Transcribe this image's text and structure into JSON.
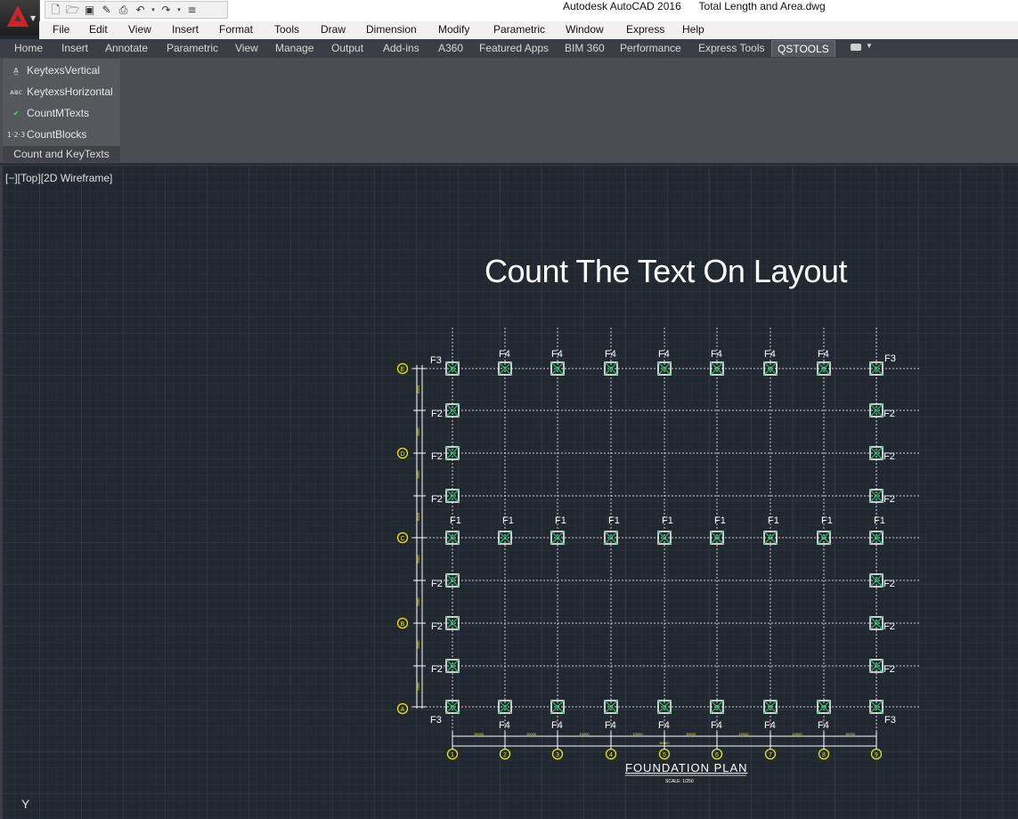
{
  "window": {
    "title": "Autodesk AutoCAD 2016      Total Length and Area.dwg"
  },
  "quick_access": {
    "icons": [
      "new-icon",
      "open-icon",
      "save-icon",
      "saveas-icon",
      "print-icon",
      "undo-icon",
      "redo-icon",
      "customize-icon"
    ]
  },
  "menu": {
    "items": [
      "File",
      "Edit",
      "View",
      "Insert",
      "Format",
      "Tools",
      "Draw",
      "Dimension",
      "Modify",
      "Parametric",
      "Window",
      "Express",
      "Help"
    ]
  },
  "ribbon_tabs": {
    "items": [
      "Home",
      "Insert",
      "Annotate",
      "Parametric",
      "View",
      "Manage",
      "Output",
      "Add-ins",
      "A360",
      "Featured Apps",
      "BIM 360",
      "Performance",
      "Express Tools",
      "QSTOOLS"
    ],
    "active": "QSTOOLS"
  },
  "ribbon_panel": {
    "buttons": [
      {
        "label": "KeytexsVertical",
        "icon": "vertical-text-icon"
      },
      {
        "label": "KeytexsHorizontal",
        "icon": "horizontal-text-icon"
      },
      {
        "label": "CountMTexts",
        "icon": "count-mtext-icon"
      },
      {
        "label": "CountBlocks",
        "icon": "count-blocks-icon"
      }
    ],
    "title": "Count and KeyTexts"
  },
  "viewport": {
    "label": "[−][Top][2D Wireframe]"
  },
  "drawing": {
    "heading": "Count The Text  On Layout",
    "plan_title": "FOUNDATION  PLAN",
    "plan_scale": "SCALE: 1/250",
    "column_axes": [
      "1",
      "2",
      "3",
      "4",
      "5",
      "6",
      "7",
      "8",
      "9"
    ],
    "row_axes": [
      "E",
      "D",
      "C",
      "B",
      "A"
    ],
    "footing_labels": {
      "corner": "F3",
      "edge_side": "F2",
      "interior_row": "F1",
      "edge_top_bottom": "F4"
    },
    "dimension_segment": "10000",
    "dimension_total": "80000",
    "vertical_dimension": "6000"
  },
  "ucs": {
    "label": "Y"
  },
  "colors": {
    "grid_bg": "#212830",
    "axis_yellow": "#e8e800",
    "footing_green": "#1fc85a"
  }
}
